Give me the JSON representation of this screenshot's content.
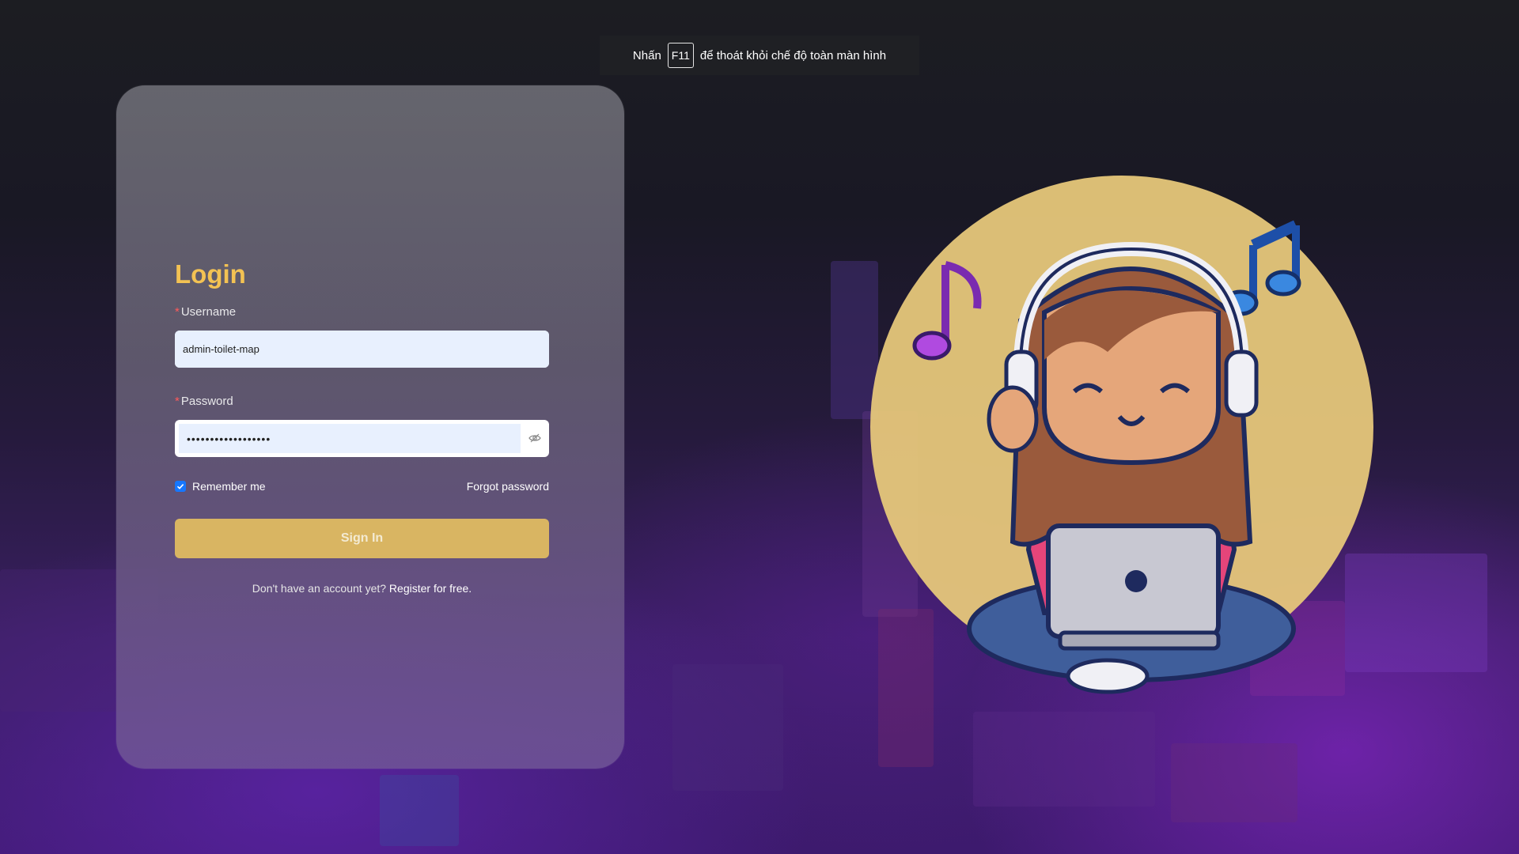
{
  "fullscreen_hint": {
    "prefix": "Nhấn",
    "key": "F11",
    "suffix": "để thoát khỏi chế độ toàn màn hình"
  },
  "login": {
    "title": "Login",
    "username_label": "Username",
    "username_value": "admin-toilet-map",
    "password_label": "Password",
    "password_value": "••••••••••••••••••",
    "remember_label": "Remember me",
    "remember_checked": true,
    "forgot_label": "Forgot password",
    "signin_label": "Sign In",
    "register_prompt": "Don't have an account yet?",
    "register_link": "Register for free."
  },
  "illustration": {
    "description_icon": "girl-with-headphones-and-laptop-icon"
  },
  "colors": {
    "accent": "#f3c253",
    "button": "#d9b562",
    "checkbox": "#1677ff",
    "input_fill": "#e8f0fe"
  }
}
